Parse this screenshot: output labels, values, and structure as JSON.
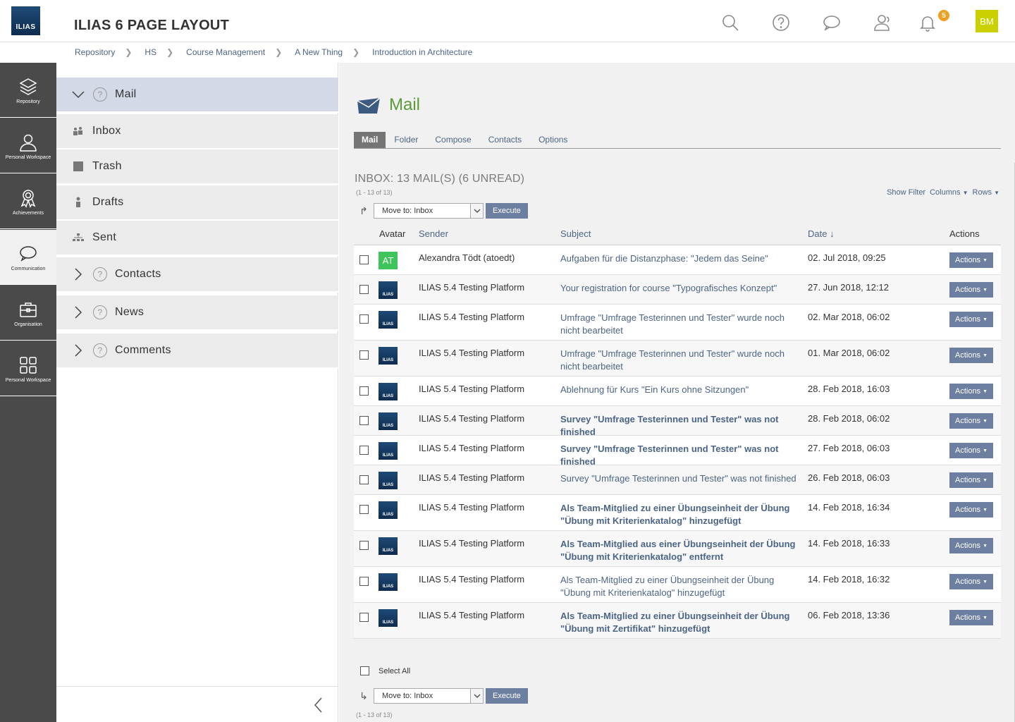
{
  "header": {
    "logo_text": "ILIAS",
    "title": "ILIAS 6 PAGE LAYOUT",
    "notifications_count": "5",
    "user_initials": "BM",
    "icons": [
      "search-icon",
      "help-icon",
      "chat-icon",
      "contacts-icon",
      "bell-icon"
    ]
  },
  "breadcrumb": [
    "Repository",
    "HS",
    "Course Management",
    "A New Thing",
    "Introduction in Architecture"
  ],
  "mainbar": [
    {
      "label": "Repository",
      "icon": "layers-icon"
    },
    {
      "label": "Personal Workspace",
      "icon": "person-icon"
    },
    {
      "label": "Achievements",
      "icon": "badge-icon"
    },
    {
      "label": "Communication",
      "icon": "chat-bubble-icon",
      "active": true
    },
    {
      "label": "Organisation",
      "icon": "briefcase-icon"
    },
    {
      "label": "Personal Workspace",
      "icon": "grid-icon"
    }
  ],
  "slate": {
    "head": "Mail",
    "items": [
      {
        "label": "Inbox",
        "icon": "inbox-icon"
      },
      {
        "label": "Trash",
        "icon": "trash-icon"
      },
      {
        "label": "Drafts",
        "icon": "drafts-icon"
      },
      {
        "label": "Sent",
        "icon": "sent-icon"
      }
    ],
    "groups": [
      "Contacts",
      "News",
      "Comments"
    ]
  },
  "content": {
    "title": "Mail",
    "tabs": [
      "Mail",
      "Folder",
      "Compose",
      "Contacts",
      "Options"
    ],
    "inbox_title": "INBOX: 13 MAIL(S) (6 UNREAD)",
    "range": "(1 - 13 of 13)",
    "view_controls": {
      "show_filter": "Show Filter",
      "columns": "Columns",
      "rows": "Rows"
    },
    "move_to": "Move to: Inbox",
    "execute": "Execute",
    "select_all": "Select All"
  },
  "table": {
    "headers": {
      "avatar": "Avatar",
      "sender": "Sender",
      "subject": "Subject",
      "date": "Date",
      "actions": "Actions"
    },
    "action_label": "Actions",
    "rows": [
      {
        "avatar": "AT",
        "sender": "Alexandra Tödt (atoedt)",
        "subject": "Aufgaben für die Distanzphase: \"Jedem das Seine\"",
        "date": "02. Jul 2018, 09:25",
        "unread": false
      },
      {
        "avatar": "ILIAS",
        "sender": "ILIAS 5.4 Testing Platform",
        "subject": "Your registration for course \"Typografisches Konzept\"",
        "date": "27. Jun 2018, 12:12",
        "unread": false
      },
      {
        "avatar": "ILIAS",
        "sender": "ILIAS 5.4 Testing Platform",
        "subject": "Umfrage \"Umfrage Testerinnen und Tester\" wurde noch nicht bearbeitet",
        "date": "02. Mar 2018, 06:02",
        "unread": false
      },
      {
        "avatar": "ILIAS",
        "sender": "ILIAS 5.4 Testing Platform",
        "subject": "Umfrage \"Umfrage Testerinnen und Tester\" wurde noch nicht bearbeitet",
        "date": "01. Mar 2018, 06:02",
        "unread": false
      },
      {
        "avatar": "ILIAS",
        "sender": "ILIAS 5.4 Testing Platform",
        "subject": "Ablehnung für Kurs \"Ein Kurs ohne Sitzungen\"",
        "date": "28. Feb 2018, 16:03",
        "unread": false
      },
      {
        "avatar": "ILIAS",
        "sender": "ILIAS 5.4 Testing Platform",
        "subject": "Survey \"Umfrage Testerinnen und Tester\" was not finished",
        "date": "28. Feb 2018, 06:02",
        "unread": true
      },
      {
        "avatar": "ILIAS",
        "sender": "ILIAS 5.4 Testing Platform",
        "subject": "Survey \"Umfrage Testerinnen und Tester\" was not finished",
        "date": "27. Feb 2018, 06:03",
        "unread": true
      },
      {
        "avatar": "ILIAS",
        "sender": "ILIAS 5.4 Testing Platform",
        "subject": "Survey \"Umfrage Testerinnen und Tester\" was not finished",
        "date": "26. Feb 2018, 06:03",
        "unread": false
      },
      {
        "avatar": "ILIAS",
        "sender": "ILIAS 5.4 Testing Platform",
        "subject": "Als Team-Mitglied zu einer Übungseinheit der Übung \"Übung mit Kriterienkatalog\" hinzugefügt",
        "date": "14. Feb 2018, 16:34",
        "unread": true
      },
      {
        "avatar": "ILIAS",
        "sender": "ILIAS 5.4 Testing Platform",
        "subject": "Als Team-Mitglied aus einer Übungseinheit der Übung \"Übung mit Kriterienkatalog\" entfernt",
        "date": "14. Feb 2018, 16:33",
        "unread": true
      },
      {
        "avatar": "ILIAS",
        "sender": "ILIAS 5.4 Testing Platform",
        "subject": "Als Team-Mitglied zu einer Übungseinheit der Übung \"Übung mit Kriterienkatalog\" hinzugefügt",
        "date": "14. Feb 2018, 16:32",
        "unread": false
      },
      {
        "avatar": "ILIAS",
        "sender": "ILIAS 5.4 Testing Platform",
        "subject": "Als Team-Mitglied zu einer Übungseinheit der Übung \"Übung mit Zertifikat\" hinzugefügt",
        "date": "06. Feb 2018, 13:36",
        "unread": true
      }
    ]
  },
  "colors": {
    "accent": "#4c6586",
    "button": "#6c7fa0",
    "title_green": "#5c9a3a",
    "mainbar": "#4a4a4a",
    "badge": "#f0a020",
    "user_avatar": "#cbd000"
  }
}
